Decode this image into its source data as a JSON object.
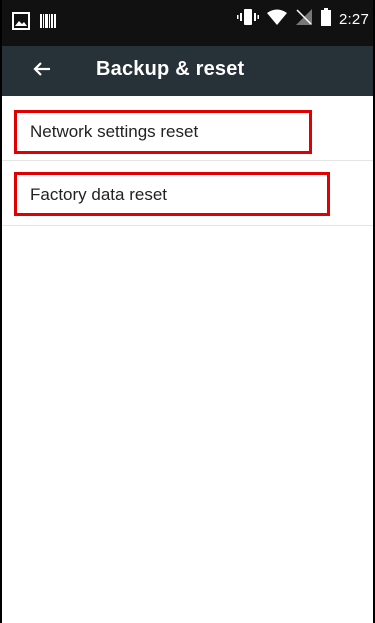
{
  "status_bar": {
    "time": "2:27",
    "icons": [
      "image-icon",
      "barcode-icon",
      "vibrate-icon",
      "wifi-icon",
      "signal-off-icon",
      "battery-icon"
    ]
  },
  "app_bar": {
    "title": "Backup & reset",
    "back_icon": "arrow-back-icon",
    "background": "#263238"
  },
  "list": {
    "items": [
      {
        "label": "Network settings reset"
      },
      {
        "label": "Factory data reset"
      }
    ]
  },
  "colors": {
    "highlight": "#e00000",
    "status_bar": "#111111",
    "divider": "#e5e5e5"
  }
}
